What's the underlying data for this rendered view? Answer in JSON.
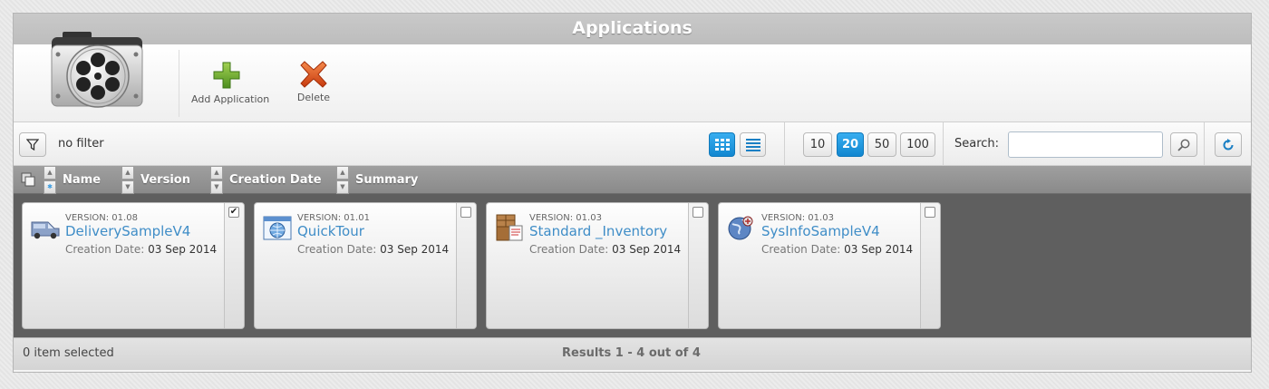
{
  "window": {
    "title": "Applications"
  },
  "toolbar": {
    "add_label": "Add Application",
    "delete_label": "Delete"
  },
  "filter": {
    "status": "no filter",
    "page_sizes": [
      "10",
      "20",
      "50",
      "100"
    ],
    "active_page_size": "20",
    "search_label": "Search:",
    "search_value": ""
  },
  "columns": [
    "Name",
    "Version",
    "Creation Date",
    "Summary"
  ],
  "cards": [
    {
      "version_label": "VERSION: 01.08",
      "name": "DeliverySampleV4",
      "date_label": "Creation Date:",
      "date": "03 Sep 2014",
      "checked": "✔",
      "icon": "van-icon"
    },
    {
      "version_label": "VERSION: 01.01",
      "name": "QuickTour",
      "date_label": "Creation Date:",
      "date": "03 Sep 2014",
      "checked": "",
      "icon": "web-window-icon"
    },
    {
      "version_label": "VERSION: 01.03",
      "name": "Standard _Inventory",
      "date_label": "Creation Date:",
      "date": "03 Sep 2014",
      "checked": "",
      "icon": "inventory-boxes-icon"
    },
    {
      "version_label": "VERSION: 01.03",
      "name": "SysInfoSampleV4",
      "date_label": "Creation Date:",
      "date": "03 Sep 2014",
      "checked": "",
      "icon": "globe-icon"
    }
  ],
  "status": {
    "selection": "0 item selected",
    "results": "Results 1 - 4 out of 4"
  },
  "colors": {
    "accent": "#1a93dc",
    "link": "#3f8dc7",
    "content_bg": "#5f5f5f",
    "header_bg": "#959595"
  }
}
